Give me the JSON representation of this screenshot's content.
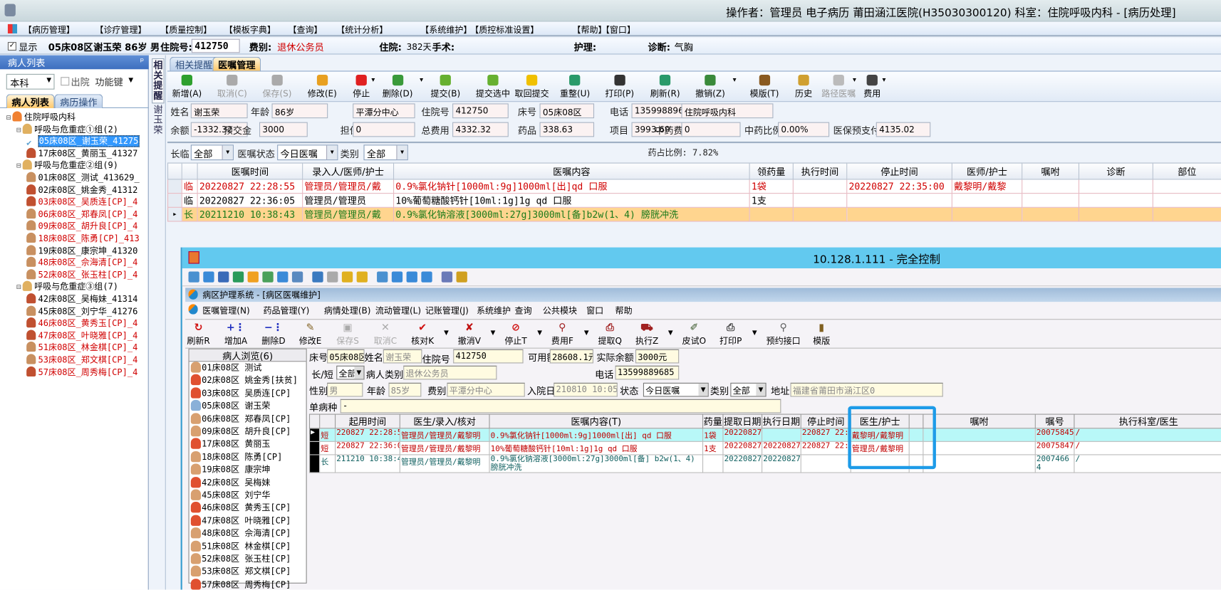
{
  "window": {
    "title": "操作者：管理员 电子病历  莆田涵江医院(H35030300120) 科室：住院呼吸内科 - [病历处理]"
  },
  "menu": [
    "【病历管理】",
    "【诊疗管理】",
    "【质量控制】",
    "【模板字典】",
    "【查询】",
    "【统计分析】",
    "【系统维护】",
    "【质控标准设置】",
    "【帮助】",
    "【窗口】"
  ],
  "patient_bar": {
    "show_label": "显示",
    "bed": "05床08区",
    "name_age_sex": "谢玉荣 86岁 男",
    "inpatient_no_label": "住院号:",
    "inpatient_no": "412750",
    "fee_type_label": "费别:",
    "fee_type": "退休公务员",
    "stay_label": "住院:",
    "stay_value": "382天",
    "surgery_label": "手术:",
    "nursing_label": "护理:",
    "diagnosis_label": "诊断:",
    "diagnosis": "气胸"
  },
  "left_panel": {
    "title": "病人列表",
    "pin": "ᵖ",
    "dept_combo": "本科",
    "discharged_label": "出院",
    "function_key": "功能键",
    "tabs": [
      "病人列表",
      "病历操作"
    ],
    "tree": [
      {
        "level": 0,
        "text": "住院呼吸内科",
        "kind": "dept"
      },
      {
        "level": 1,
        "text": "呼吸与危重症①组(2)",
        "kind": "group"
      },
      {
        "level": 2,
        "text": "05床08区_谢玉荣_41275",
        "kind": "selected",
        "color": "#000"
      },
      {
        "level": 2,
        "text": "17床08区_黄丽玉_41327",
        "kind": "female",
        "color": "#000"
      },
      {
        "level": 1,
        "text": "呼吸与危重症②组(9)",
        "kind": "group"
      },
      {
        "level": 2,
        "text": "01床08区_测试_413629_",
        "kind": "male",
        "color": "#000"
      },
      {
        "level": 2,
        "text": "02床08区_姚金秀_41312",
        "kind": "female",
        "color": "#000"
      },
      {
        "level": 2,
        "text": "03床08区_吴质连[CP]_4",
        "kind": "female",
        "color": "#d00000"
      },
      {
        "level": 2,
        "text": "06床08区_郑春凤[CP]_4",
        "kind": "male",
        "color": "#d00000"
      },
      {
        "level": 2,
        "text": "09床08区_胡升良[CP]_4",
        "kind": "male",
        "color": "#d00000"
      },
      {
        "level": 2,
        "text": "18床08区_陈勇[CP]_413",
        "kind": "male",
        "color": "#d00000"
      },
      {
        "level": 2,
        "text": "19床08区_康宗坤_41320",
        "kind": "male",
        "color": "#000"
      },
      {
        "level": 2,
        "text": "48床08区_佘海清[CP]_4",
        "kind": "male",
        "color": "#d00000"
      },
      {
        "level": 2,
        "text": "52床08区_张玉柱[CP]_4",
        "kind": "male",
        "color": "#d00000"
      },
      {
        "level": 1,
        "text": "呼吸与危重症③组(7)",
        "kind": "group"
      },
      {
        "level": 2,
        "text": "42床08区_吴梅妹_41314",
        "kind": "female",
        "color": "#000"
      },
      {
        "level": 2,
        "text": "45床08区_刘宁华_41276",
        "kind": "male",
        "color": "#000"
      },
      {
        "level": 2,
        "text": "46床08区_黄秀玉[CP]_4",
        "kind": "female",
        "color": "#d00000"
      },
      {
        "level": 2,
        "text": "47床08区_叶晓雅[CP]_4",
        "kind": "female",
        "color": "#d00000"
      },
      {
        "level": 2,
        "text": "51床08区_林金棋[CP]_4",
        "kind": "male",
        "color": "#d00000"
      },
      {
        "level": 2,
        "text": "53床08区_郑文棋[CP]_4",
        "kind": "male",
        "color": "#d00000"
      },
      {
        "level": 2,
        "text": "57床08区_周秀梅[CP]_4",
        "kind": "female",
        "color": "#d00000"
      }
    ]
  },
  "vertical_tabs": [
    "相关提醒",
    "谢玉荣"
  ],
  "main": {
    "tabs": [
      "相关提醒",
      "医嘱管理"
    ],
    "toolbar": [
      {
        "label": "新增(A)",
        "icon": "plus-circle-icon",
        "color": "#2ea02e"
      },
      {
        "label": "取消(C)",
        "icon": "undo-icon",
        "color": "#aaa",
        "disabled": true
      },
      {
        "label": "保存(S)",
        "icon": "save-icon",
        "color": "#aaa",
        "disabled": true
      },
      {
        "label": "修改(E)",
        "icon": "eraser-icon",
        "color": "#e8a020"
      },
      {
        "label": "停止",
        "icon": "stop-icon",
        "color": "#e02020",
        "dropdown": true
      },
      {
        "label": "删除(D)",
        "icon": "minus-circle-icon",
        "color": "#3a9a3a",
        "dropdown": true
      },
      {
        "label": "提交(B)",
        "icon": "check-icon",
        "color": "#66b030"
      },
      {
        "label": "提交选中",
        "icon": "check-selected-icon",
        "color": "#66b030"
      },
      {
        "label": "取回提交",
        "icon": "retrieve-icon",
        "color": "#f0c000"
      },
      {
        "label": "重整(U)",
        "icon": "reorganize-icon",
        "color": "#2a9a6a"
      },
      {
        "label": "打印(P)",
        "icon": "printer-icon",
        "color": "#333"
      },
      {
        "label": "刷新(R)",
        "icon": "refresh-icon",
        "color": "#2a9a6a"
      },
      {
        "label": "撤销(Z)",
        "icon": "trash-icon",
        "color": "#3a8a3a",
        "dropdown": true
      },
      {
        "label": "模版(T)",
        "icon": "book-icon",
        "color": "#8a5a20"
      },
      {
        "label": "历史",
        "icon": "history-icon",
        "color": "#d0a030"
      },
      {
        "label": "路径医嘱",
        "icon": "path-order-icon",
        "color": "#bbb",
        "disabled": true,
        "dropdown": true
      },
      {
        "label": "费用",
        "icon": "calculator-icon",
        "color": "#444",
        "dropdown": true
      }
    ],
    "info_row1": [
      [
        "姓名",
        "谢玉荣"
      ],
      [
        "年龄",
        "86岁"
      ],
      [
        "医保",
        "平潭分中心"
      ],
      [
        "住院号",
        "412750"
      ],
      [
        "床号",
        "05床08区"
      ],
      [
        "电话",
        "13599889685"
      ],
      [
        "科别",
        "住院呼吸内科"
      ]
    ],
    "info_row2": [
      [
        "余额",
        "-1332.32"
      ],
      [
        "预交金",
        "3000"
      ],
      [
        "担保",
        "0"
      ],
      [
        "总费用",
        "4332.32"
      ],
      [
        "药品",
        "338.63"
      ],
      [
        "项目",
        "3993.69"
      ],
      [
        "中药费",
        "0"
      ],
      [
        "中药比例",
        "0.00%"
      ],
      [
        "医保预支付",
        "4135.02"
      ]
    ],
    "filters": {
      "long_temp_label": "长临",
      "long_temp": "全部",
      "status_label": "医嘱状态",
      "status": "今日医嘱",
      "category_label": "类别",
      "category": "全部",
      "drug_ratio": "药占比例: 7.82%"
    },
    "grid": {
      "columns": [
        "",
        "",
        "医嘱时间",
        "录入人/医师/护士",
        "医嘱内容",
        "领药量",
        "执行时间",
        "停止时间",
        "医师/护士",
        "嘱咐",
        "诊断",
        "部位"
      ],
      "rows": [
        {
          "type": "临",
          "time": "20220827 22:28:55",
          "entry": "管理员/管理员/戴",
          "content": "0.9%氯化钠针[1000ml:9g]1000ml[出]qd 口服",
          "qty": "1袋",
          "exec": "",
          "stop": "20220827 22:35:00",
          "doctor": "戴黎明/戴黎",
          "advice": "",
          "diag": "",
          "site": "",
          "style": "stopped"
        },
        {
          "type": "临",
          "time": "20220827 22:36:05",
          "entry": "管理员/管理员",
          "content": "10%葡萄糖酸钙针[10ml:1g]1g qd 口服",
          "qty": "1支",
          "exec": "",
          "stop": "",
          "doctor": "",
          "advice": "",
          "diag": "",
          "site": "",
          "style": "normal"
        },
        {
          "type": "长",
          "time": "20211210 10:38:43",
          "entry": "管理员/管理员/戴",
          "content": "0.9%氯化钠溶液[3000ml:27g]3000ml[备]b2w(1、4) 膀胱冲洗",
          "qty": "",
          "exec": "",
          "stop": "",
          "doctor": "",
          "advice": "",
          "diag": "",
          "site": "",
          "style": "selected"
        }
      ]
    }
  },
  "remote": {
    "title": "10.128.1.111 - 完全控制",
    "inner_title": "病区护理系统 - [病区医嘱维护]",
    "menu": [
      "医嘱管理(N)",
      "药品管理(Y)",
      "病情处理(B)",
      "流动管理(L)",
      "记账管理(J)",
      "系统维护",
      "查询",
      "公共模块",
      "窗口",
      "帮助"
    ],
    "toolbar": [
      {
        "label": "刷新R",
        "glyph": "↻",
        "color": "#d01010"
      },
      {
        "label": "增加A",
        "glyph": "+⋮",
        "color": "#2030c0"
      },
      {
        "label": "删除D",
        "glyph": "−⋮",
        "color": "#2030c0"
      },
      {
        "label": "修改E",
        "glyph": "✎",
        "color": "#806020"
      },
      {
        "label": "保存S",
        "glyph": "▣",
        "color": "#aaa",
        "disabled": true
      },
      {
        "label": "取消C",
        "glyph": "✕",
        "color": "#aaa",
        "disabled": true
      },
      {
        "label": "核对K",
        "glyph": "✔",
        "color": "#d01010",
        "dropdown": true
      },
      {
        "label": "撤消V",
        "glyph": "✘",
        "color": "#c01010",
        "dropdown": true
      },
      {
        "label": "停止T",
        "glyph": "⊘",
        "color": "#d01010",
        "dropdown": true
      },
      {
        "label": "费用F",
        "glyph": "⚲",
        "color": "#a02020",
        "dropdown": true
      },
      {
        "label": "提取Q",
        "glyph": "⎙",
        "color": "#a02020"
      },
      {
        "label": "执行Z",
        "glyph": "⛟",
        "color": "#a02020",
        "dropdown": true
      },
      {
        "label": "皮试O",
        "glyph": "✐",
        "color": "#305020"
      },
      {
        "label": "打印P",
        "glyph": "⎙",
        "color": "#404040",
        "dropdown": true
      },
      {
        "label": "预约接口",
        "glyph": "⚲",
        "color": "#606060"
      },
      {
        "label": "模版",
        "glyph": "▮",
        "color": "#806020"
      }
    ],
    "patient_list": {
      "title": "病人浏览(6)",
      "items": [
        {
          "text": "01床08区 测试",
          "kind": "male"
        },
        {
          "text": "02床08区 姚金秀[扶贫]",
          "kind": "female"
        },
        {
          "text": "03床08区 吴质连[CP]",
          "kind": "female"
        },
        {
          "text": "05床08区 谢玉荣",
          "kind": "current"
        },
        {
          "text": "06床08区 郑春凤[CP]",
          "kind": "male"
        },
        {
          "text": "09床08区 胡升良[CP]",
          "kind": "male"
        },
        {
          "text": "17床08区 黄丽玉",
          "kind": "female"
        },
        {
          "text": "18床08区 陈勇[CP]",
          "kind": "male"
        },
        {
          "text": "19床08区 康宗坤",
          "kind": "male"
        },
        {
          "text": "42床08区 吴梅妹",
          "kind": "female"
        },
        {
          "text": "45床08区 刘宁华",
          "kind": "male"
        },
        {
          "text": "46床08区 黄秀玉[CP]",
          "kind": "female"
        },
        {
          "text": "47床08区 叶晓雅[CP]",
          "kind": "female"
        },
        {
          "text": "48床08区 佘海清[CP]",
          "kind": "male"
        },
        {
          "text": "51床08区 林金棋[CP]",
          "kind": "male"
        },
        {
          "text": "52床08区 张玉柱[CP]",
          "kind": "male"
        },
        {
          "text": "53床08区 郑文棋[CP]",
          "kind": "male"
        },
        {
          "text": "57床08区 周秀梅[CP]",
          "kind": "female"
        }
      ]
    },
    "form": {
      "bed_label": "床号",
      "bed": "05床08区",
      "name_label": "姓名",
      "name": "谢玉荣",
      "inpatient_no_label": "住院号",
      "inpatient_no": "412750",
      "available_label": "可用额",
      "available": "28608.1元",
      "balance_label": "实际余额",
      "balance": "3000元",
      "long_short_label": "长/短",
      "long_short": "全部",
      "patient_type_label": "病人类别",
      "patient_type": "退休公务员",
      "phone_label": "电话",
      "phone": "13599889685",
      "sex_label": "性别",
      "sex": "男",
      "age_label": "年龄",
      "age": "85岁",
      "fee_label": "费别",
      "fee": "平潭分中心",
      "admit_label": "入院日",
      "admit": "210810 10:05",
      "state_label": "状态",
      "state": "今日医嘱",
      "category_label": "类别",
      "category": "全部",
      "address_label": "地址",
      "address": "福建省莆田市涵江区0",
      "single_disease_label": "单病种",
      "single_disease": "-"
    },
    "grid": {
      "columns": [
        "",
        "",
        "起用时间",
        "医生/录入/核对",
        "医嘱内容(T)",
        "药量",
        "提取日期",
        "执行日期",
        "停止时间",
        "医生/护士",
        "",
        "嘱咐",
        "嘱号",
        "执行科室/医生"
      ],
      "rows": [
        {
          "marker": "▶",
          "type": "短",
          "start": "220827 22:28:55",
          "doctor": "管理员/管理员/戴黎明",
          "content": "0.9%氯化钠针[1000ml:9g]1000ml[出] qd 口服",
          "qty": "1袋",
          "fetch": "20220827",
          "exec": "",
          "stop": "220827 22:35",
          "docnurse": "戴黎明/戴黎明",
          "x": "",
          "advice": "",
          "no": "20075845",
          "dept": "/",
          "style": "current"
        },
        {
          "marker": "",
          "type": "短",
          "start": "220827 22:36:05",
          "doctor": "管理员/管理员/戴黎明",
          "content": "10%葡萄糖酸钙针[10ml:1g]1g qd 口服",
          "qty": "1支",
          "fetch": "20220827",
          "exec": "20220827",
          "stop": "220827 22:36",
          "docnurse": "管理员/戴黎明",
          "x": "",
          "advice": "",
          "no": "20075847",
          "dept": "/",
          "style": "red"
        },
        {
          "marker": "",
          "type": "长",
          "start": "211210 10:38:43",
          "doctor": "管理员/管理员/戴黎明",
          "content": "0.9%氯化钠溶液[3000ml:27g]3000ml[备] b2w(1、4) 膀胱冲洗",
          "qty": "",
          "fetch": "20220827",
          "exec": "20220827",
          "stop": "",
          "docnurse": "",
          "x": "",
          "advice": "",
          "no": "20074664",
          "dept": "/",
          "style": "long"
        }
      ]
    }
  },
  "colors": {
    "accent_tab": "#ffc86a",
    "selected_row": "#ffd58f",
    "remote_title": "#62c9ef",
    "current_row": "#b8f8f8",
    "highlight_box": "#1d9be8",
    "red_text": "#d00000",
    "green_text": "#1a7a1a"
  }
}
